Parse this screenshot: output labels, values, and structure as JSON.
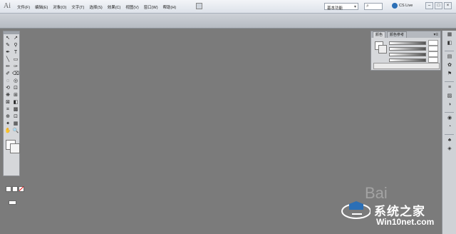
{
  "app": {
    "logo": "Ai"
  },
  "menu": [
    "文件(F)",
    "编辑(E)",
    "对象(O)",
    "文字(T)",
    "选择(S)",
    "效果(C)",
    "视图(V)",
    "窗口(W)",
    "帮助(H)"
  ],
  "workspace": {
    "selected": "基本功能",
    "arrow": "▾"
  },
  "cslive": {
    "label": "CS Live"
  },
  "window_controls": {
    "minimize": "–",
    "restore": "□",
    "close": "×"
  },
  "tools": [
    "↖",
    "↗",
    "✎",
    "⚲",
    "✒",
    "T",
    "╲",
    "▭",
    "✏",
    "✑",
    "✐",
    "⌫",
    "◌",
    "◎",
    "⟲",
    "⊡",
    "❋",
    "⊞",
    "⊠",
    "◧",
    "⌗",
    "▩",
    "⊕",
    "⊡",
    "✦",
    "▦",
    "⬚",
    "✍",
    "✋",
    "🔍"
  ],
  "color_panel": {
    "tabs": [
      "颜色",
      "颜色参考"
    ],
    "menu_icon": "▾≡",
    "close_icon": "×"
  },
  "dock_icons": [
    "▦",
    "◧",
    "▤",
    "✿",
    "⚑",
    "≡",
    "▨",
    "◑",
    "◉",
    "◔",
    "♣",
    "◈"
  ],
  "watermark": {
    "title": "系统之家",
    "url": "Win10net.com",
    "paw": "Bai"
  },
  "colors": {
    "canvas": "#7b7b7b",
    "accent": "#2b6fb6"
  }
}
